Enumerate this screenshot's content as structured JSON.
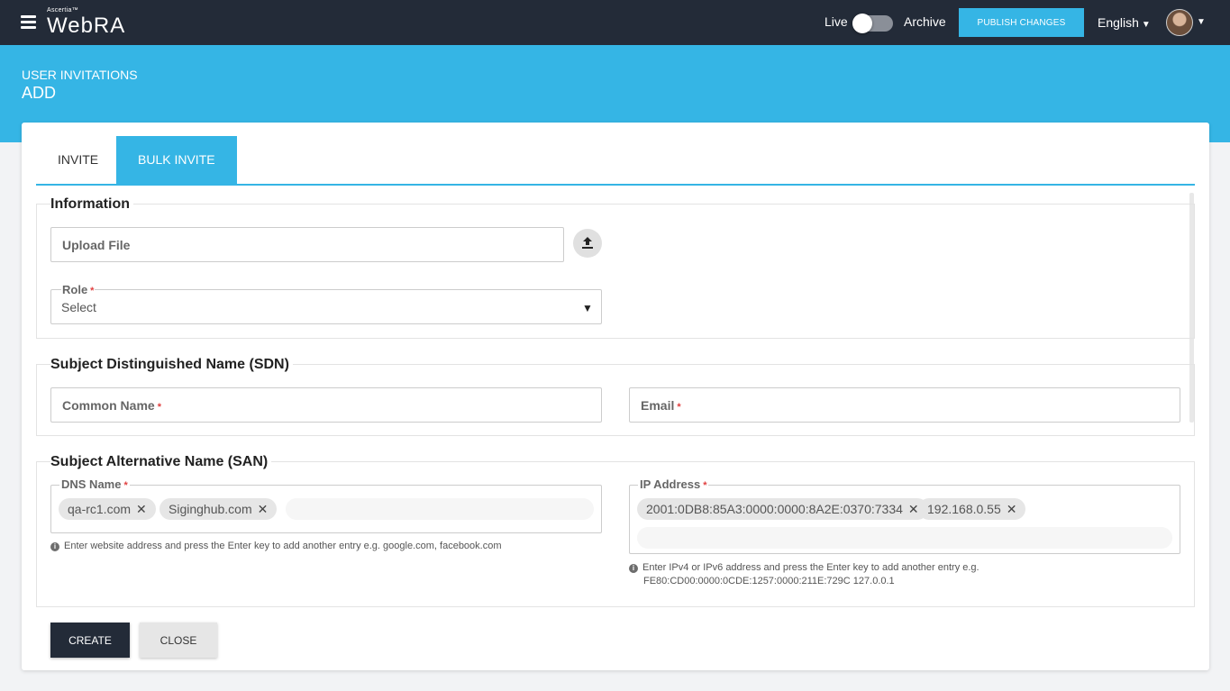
{
  "topbar": {
    "brand_small": "Ascertia™",
    "brand_name": "WebRA",
    "live_label": "Live",
    "archive_label": "Archive",
    "publish_label": "PUBLISH CHANGES",
    "language": "English"
  },
  "header": {
    "breadcrumb": "USER INVITATIONS",
    "title": "ADD"
  },
  "tabs": [
    {
      "label": "INVITE",
      "active": false
    },
    {
      "label": "BULK INVITE",
      "active": true
    }
  ],
  "information": {
    "title": "Information",
    "upload_placeholder": "Upload File",
    "role_label": "Role",
    "role_value": "Select"
  },
  "sdn": {
    "title": "Subject Distinguished Name (SDN)",
    "common_name_label": "Common Name",
    "email_label": "Email"
  },
  "san": {
    "title": "Subject Alternative Name (SAN)",
    "dns_label": "DNS Name",
    "dns_values": [
      "qa-rc1.com",
      "Siginghub.com"
    ],
    "dns_hint": "Enter website address and press the Enter key to add another entry e.g. google.com, facebook.com",
    "ip_label": "IP Address",
    "ip_values": [
      "2001:0DB8:85A3:0000:0000:8A2E:0370:7334",
      "192.168.0.55"
    ],
    "ip_hint_line1": "Enter IPv4 or IPv6 address and press the Enter key to add another entry e.g.",
    "ip_hint_line2": "FE80:CD00:0000:0CDE:1257:0000:211E:729C 127.0.0.1"
  },
  "required_mark": "*",
  "remove_glyph": "✕",
  "actions": {
    "create_label": "CREATE",
    "close_label": "CLOSE"
  },
  "colors": {
    "topbar": "#232b38",
    "accent": "#35b5e5",
    "required": "#e04040"
  }
}
